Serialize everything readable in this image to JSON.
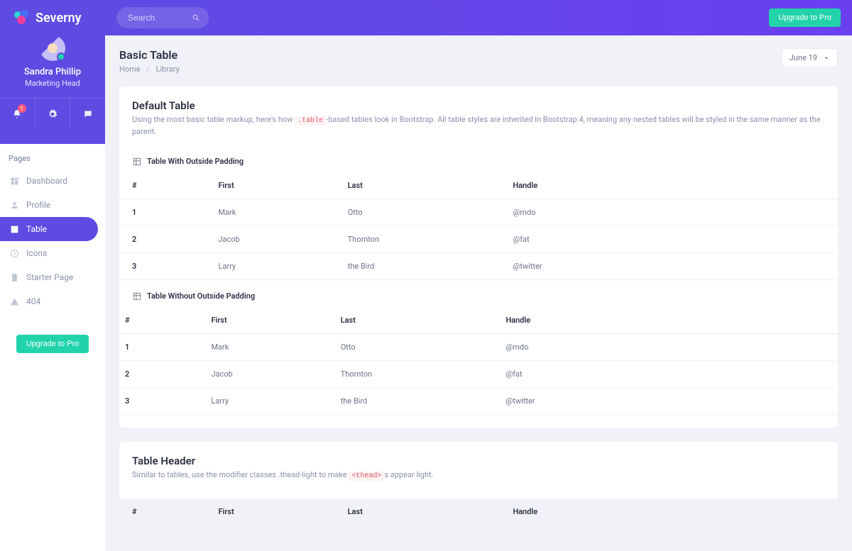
{
  "brand": "Severny",
  "search": {
    "placeholder": "Search"
  },
  "upgrade_label": "Upgrade to Pro",
  "user": {
    "name": "Sandra Phillip",
    "role": "Marketing Head",
    "notif_badge": "1"
  },
  "sidebar": {
    "section": "Pages",
    "items": [
      {
        "label": "Dashboard",
        "name": "dashboard"
      },
      {
        "label": "Profile",
        "name": "profile"
      },
      {
        "label": "Table",
        "name": "table",
        "active": true
      },
      {
        "label": "Icons",
        "name": "icons"
      },
      {
        "label": "Starter Page",
        "name": "starter-page"
      },
      {
        "label": "404",
        "name": "404"
      }
    ]
  },
  "page": {
    "title": "Basic Table",
    "breadcrumb": [
      "Home",
      "Library"
    ],
    "date": "June 19"
  },
  "card1": {
    "title": "Default Table",
    "desc_pre": "Using the most basic table markup, here's how ",
    "desc_code": ".table",
    "desc_post": "-based tables look in Bootstrap. All table styles are inherited in Bootstrap 4, meaning any nested tables will be styled in the same manner as the parent.",
    "table1_title": "Table With Outside Padding",
    "table2_title": "Table Without Outside Padding",
    "headers": [
      "#",
      "First",
      "Last",
      "Handle"
    ],
    "rows": [
      {
        "num": "1",
        "first": "Mark",
        "last": "Otto",
        "handle": "@mdo"
      },
      {
        "num": "2",
        "first": "Jacob",
        "last": "Thornton",
        "handle": "@fat"
      },
      {
        "num": "3",
        "first": "Larry",
        "last": "the Bird",
        "handle": "@twitter"
      }
    ]
  },
  "card2": {
    "title": "Table Header",
    "desc_pre": "Similar to tables, use the modifier classes .thead-light to make ",
    "desc_code": "<thead>",
    "desc_post": "s appear light.",
    "headers": [
      "#",
      "First",
      "Last",
      "Handle"
    ]
  }
}
